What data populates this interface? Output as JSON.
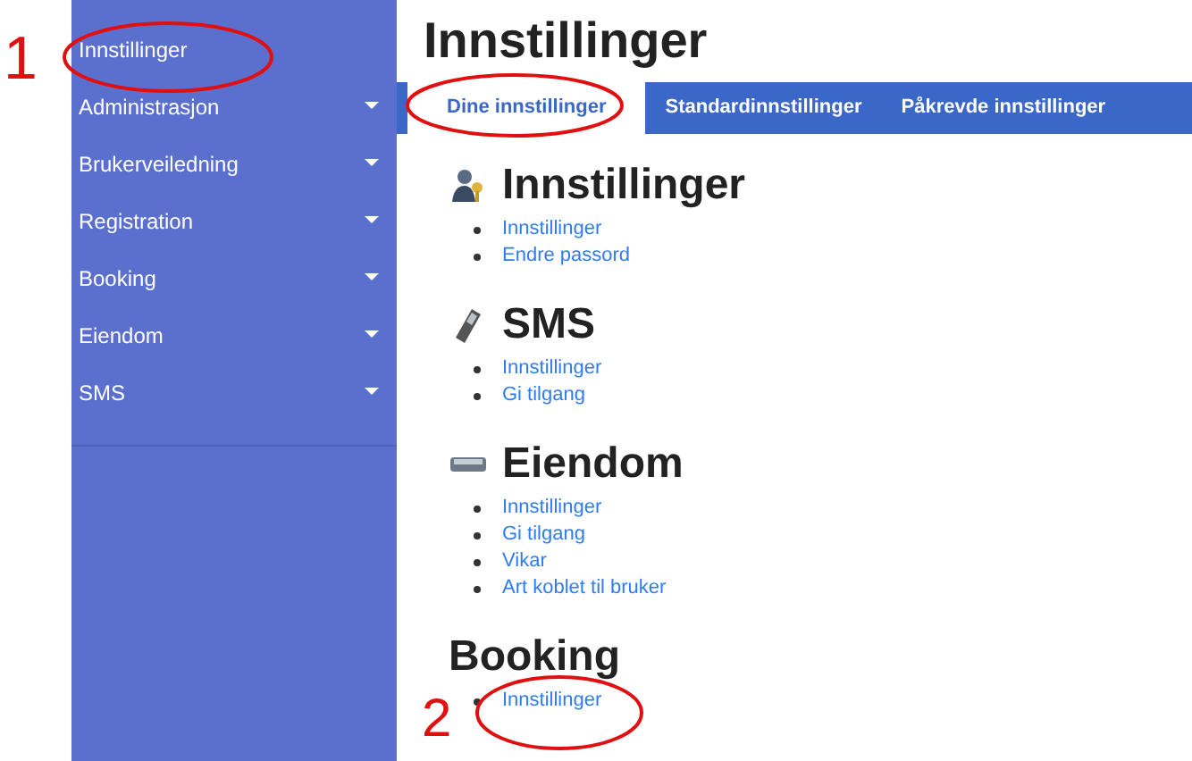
{
  "sidebar": {
    "items": [
      {
        "label": "Innstillinger",
        "has_submenu": false
      },
      {
        "label": "Administrasjon",
        "has_submenu": true
      },
      {
        "label": "Brukerveiledning",
        "has_submenu": true
      },
      {
        "label": "Registration",
        "has_submenu": true
      },
      {
        "label": "Booking",
        "has_submenu": true
      },
      {
        "label": "Eiendom",
        "has_submenu": true
      },
      {
        "label": "SMS",
        "has_submenu": true
      }
    ]
  },
  "page_title": "Innstillinger",
  "tabs": [
    {
      "label": "Dine innstillinger",
      "selected": true
    },
    {
      "label": "Standardinnstillinger",
      "selected": false
    },
    {
      "label": "Påkrevde innstillinger",
      "selected": false
    }
  ],
  "sections": [
    {
      "title": "Innstillinger",
      "kind": "user-key",
      "links": [
        "Innstillinger",
        "Endre passord"
      ]
    },
    {
      "title": "SMS",
      "kind": "phone",
      "links": [
        "Innstillinger",
        "Gi tilgang"
      ]
    },
    {
      "title": "Eiendom",
      "kind": "drive",
      "links": [
        "Innstillinger",
        "Gi tilgang",
        "Vikar",
        "Art koblet til bruker"
      ]
    },
    {
      "title": "Booking",
      "kind": "plain",
      "links": [
        "Innstillinger"
      ]
    }
  ],
  "annotations": [
    {
      "label": "1"
    },
    {
      "label": "2"
    }
  ]
}
